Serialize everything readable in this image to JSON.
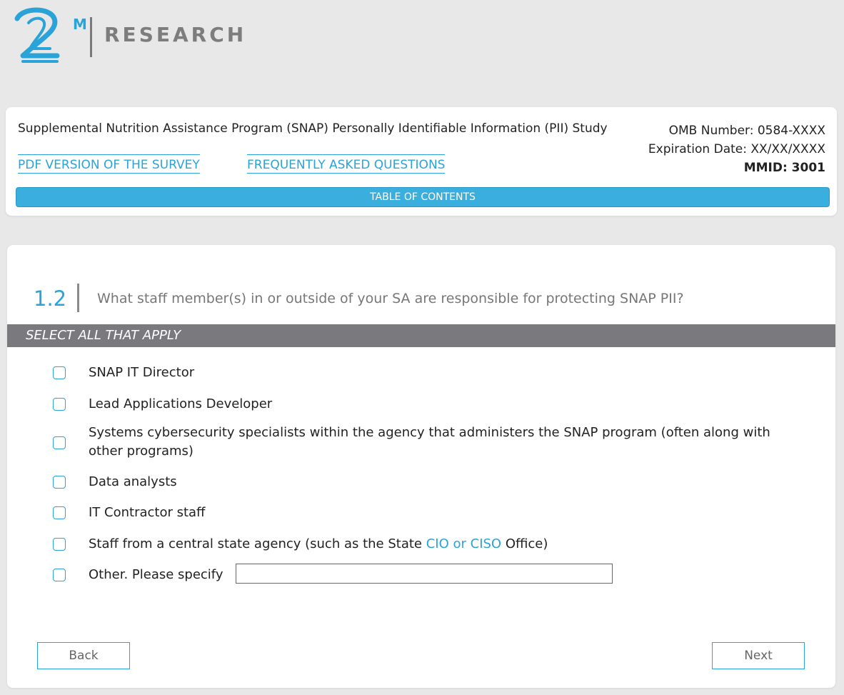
{
  "logo": {
    "icon": "two-m-logo-icon",
    "superscript": "M",
    "wordmark": "RESEARCH",
    "brand_color": "#2aa3d9"
  },
  "header": {
    "study_title": "Supplemental Nutrition Assistance Program (SNAP) Personally Identifiable Information (PII) Study",
    "omb_number": "OMB Number: 0584-XXXX",
    "expiration": "Expiration Date: XX/XX/XXXX",
    "mmid": "MMID: 3001",
    "pdf_link": "PDF VERSION OF THE SURVEY",
    "faq_link": "FREQUENTLY ASKED QUESTIONS",
    "toc_label": "TABLE OF CONTENTS"
  },
  "question": {
    "number": "1.2",
    "text": "What staff member(s) in or outside of your SA are responsible for protecting SNAP PII?",
    "instruction": "SELECT ALL THAT APPLY",
    "options": [
      {
        "label": "SNAP IT Director"
      },
      {
        "label": "Lead Applications Developer"
      },
      {
        "label_line1": "Systems cybersecurity specialists within the agency that administers the SNAP program (often along with",
        "label_line2": "other programs)"
      },
      {
        "label": "Data analysts"
      },
      {
        "label": "IT Contractor staff"
      },
      {
        "label_pre": "Staff from a central state agency (such as the State ",
        "label_hl": "CIO or CISO",
        "label_post": " Office)"
      },
      {
        "label": "Other. Please specify"
      }
    ],
    "specify_value": ""
  },
  "nav": {
    "back_label": "Back",
    "next_label": "Next"
  },
  "colors": {
    "accent": "#2aa3d9",
    "band": "#7a7a7e",
    "background": "#e8e8e8"
  }
}
